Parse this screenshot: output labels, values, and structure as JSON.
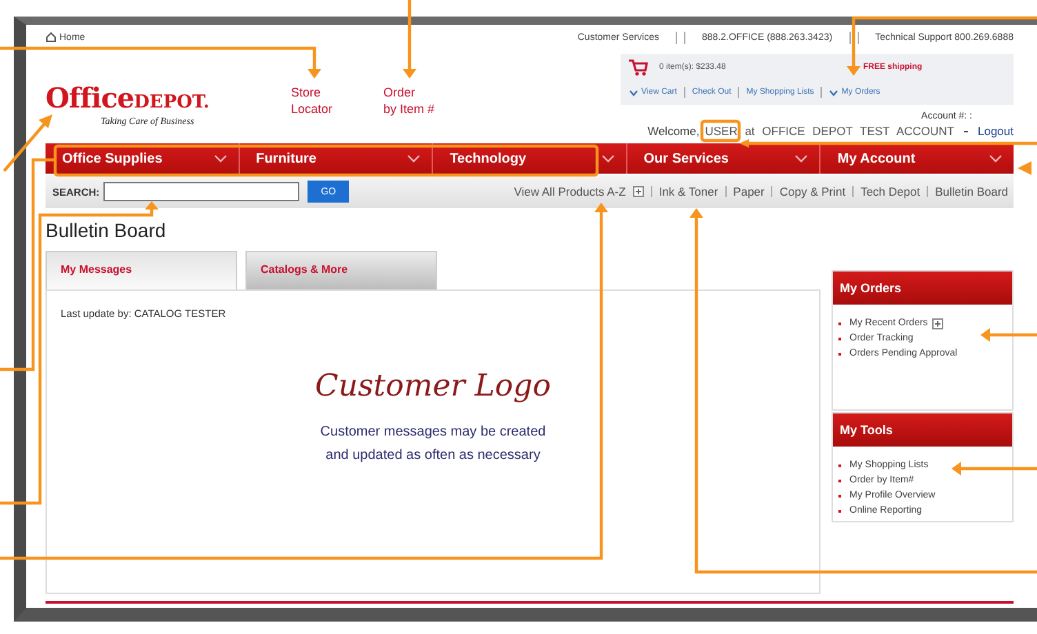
{
  "top_bar": {
    "home": "Home",
    "links": [
      "Customer Services",
      "888.2.OFFICE (888.263.3423)",
      "Technical Support 800.269.6888"
    ]
  },
  "logo": {
    "word1": "Office",
    "word2": "DEPOT.",
    "tagline": "Taking Care of Business"
  },
  "header_links": [
    {
      "lines": [
        "Store",
        "Locator"
      ]
    },
    {
      "lines": [
        "Order",
        "by Item #"
      ]
    }
  ],
  "cart": {
    "summary": "0 item(s): $233.48",
    "promo": "FREE shipping",
    "links": [
      {
        "label": "View Cart",
        "arrow": true
      },
      {
        "label": "Check Out",
        "arrow": false
      },
      {
        "label": "My Shopping Lists",
        "arrow": false
      },
      {
        "label": "My Orders",
        "arrow": true
      }
    ]
  },
  "account": {
    "number_label": "Account #: :",
    "welcome": "Welcome,",
    "user": "USER at OFFICE DEPOT TEST ACCOUNT",
    "logout": "Logout"
  },
  "nav": [
    {
      "label": "Office Supplies"
    },
    {
      "label": "Furniture"
    },
    {
      "label": "Technology"
    },
    {
      "label": "Our Services"
    },
    {
      "label": "My Account"
    }
  ],
  "search": {
    "label": "SEARCH:",
    "button": "GO"
  },
  "quick_links": [
    {
      "label": "View All Products A-Z",
      "expandable": true
    },
    {
      "label": "Ink & Toner",
      "expandable": false
    },
    {
      "label": "Paper",
      "expandable": false
    },
    {
      "label": "Copy & Print",
      "expandable": false
    },
    {
      "label": "Tech Depot",
      "expandable": false
    },
    {
      "label": "Bulletin Board",
      "expandable": false
    }
  ],
  "page_title": "Bulletin Board",
  "tabs": [
    {
      "label": "My Messages",
      "selected": true
    },
    {
      "label": "Catalogs & More",
      "selected": false
    }
  ],
  "message": {
    "last_update": "Last update by: CATALOG TESTER",
    "logo_text": "Customer Logo",
    "lines": [
      "Customer messages may be created",
      "and updated as often as necessary"
    ]
  },
  "sidebar": [
    {
      "title": "My Orders",
      "items": [
        {
          "label": "My Recent Orders",
          "expandable": true
        },
        {
          "label": "Order Tracking",
          "expandable": false
        },
        {
          "label": "Orders Pending Approval",
          "expandable": false
        }
      ]
    },
    {
      "title": "My Tools",
      "items": [
        {
          "label": "My Shopping Lists",
          "expandable": false
        },
        {
          "label": "Order by Item#",
          "expandable": false
        },
        {
          "label": "My Profile Overview",
          "expandable": false
        },
        {
          "label": "Online Reporting",
          "expandable": false
        }
      ]
    }
  ]
}
